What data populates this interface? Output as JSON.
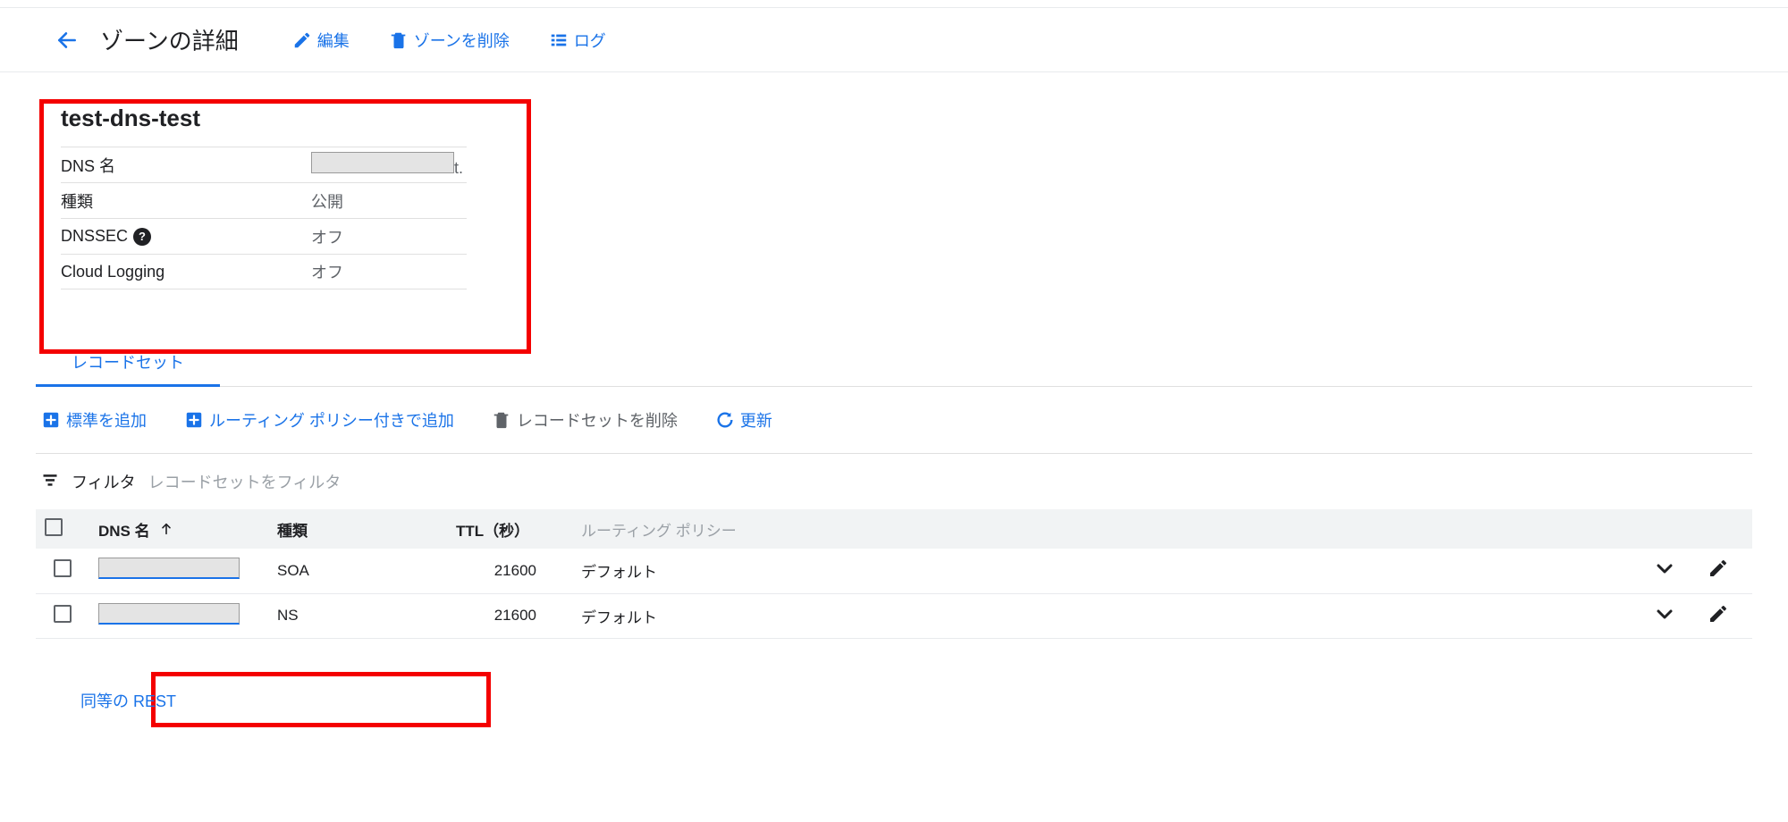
{
  "header": {
    "title": "ゾーンの詳細",
    "edit": "編集",
    "delete_zone": "ゾーンを削除",
    "logs": "ログ"
  },
  "zone": {
    "name": "test-dns-test",
    "meta": [
      {
        "label": "DNS 名",
        "value": "",
        "redacted": true,
        "suffix": "t."
      },
      {
        "label": "種類",
        "value": "公開"
      },
      {
        "label": "DNSSEC",
        "value": "オフ",
        "help": true
      },
      {
        "label": "Cloud Logging",
        "value": "オフ"
      }
    ]
  },
  "tabs": {
    "record_sets": "レコードセット"
  },
  "toolbar": {
    "add_standard": "標準を追加",
    "add_with_routing": "ルーティング ポリシー付きで追加",
    "delete_recordset": "レコードセットを削除",
    "refresh": "更新"
  },
  "filter": {
    "label": "フィルタ",
    "placeholder": "レコードセットをフィルタ"
  },
  "table": {
    "columns": {
      "dns_name": "DNS 名",
      "type": "種類",
      "ttl": "TTL（秒）",
      "routing_policy": "ルーティング ポリシー"
    },
    "rows": [
      {
        "dns_name": "",
        "type": "SOA",
        "ttl": "21600",
        "policy": "デフォルト"
      },
      {
        "dns_name": "",
        "type": "NS",
        "ttl": "21600",
        "policy": "デフォルト"
      }
    ]
  },
  "footer": {
    "rest_equiv": "同等の REST"
  }
}
